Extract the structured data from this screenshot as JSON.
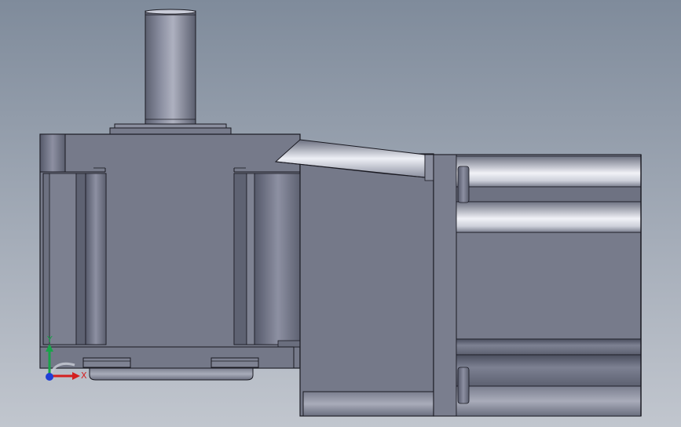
{
  "viewport": {
    "background_top": "#7f8b9b",
    "background_bottom": "#c1c6ce"
  },
  "model": {
    "body_color": "#767a8a",
    "edge_color": "#1a1a22",
    "highlight_color": "#e9ebf2"
  },
  "triad": {
    "y_label": "Y",
    "x_label": "X",
    "y_color": "#19a34a",
    "x_color": "#d42020",
    "z_color": "#1f3fd6"
  }
}
